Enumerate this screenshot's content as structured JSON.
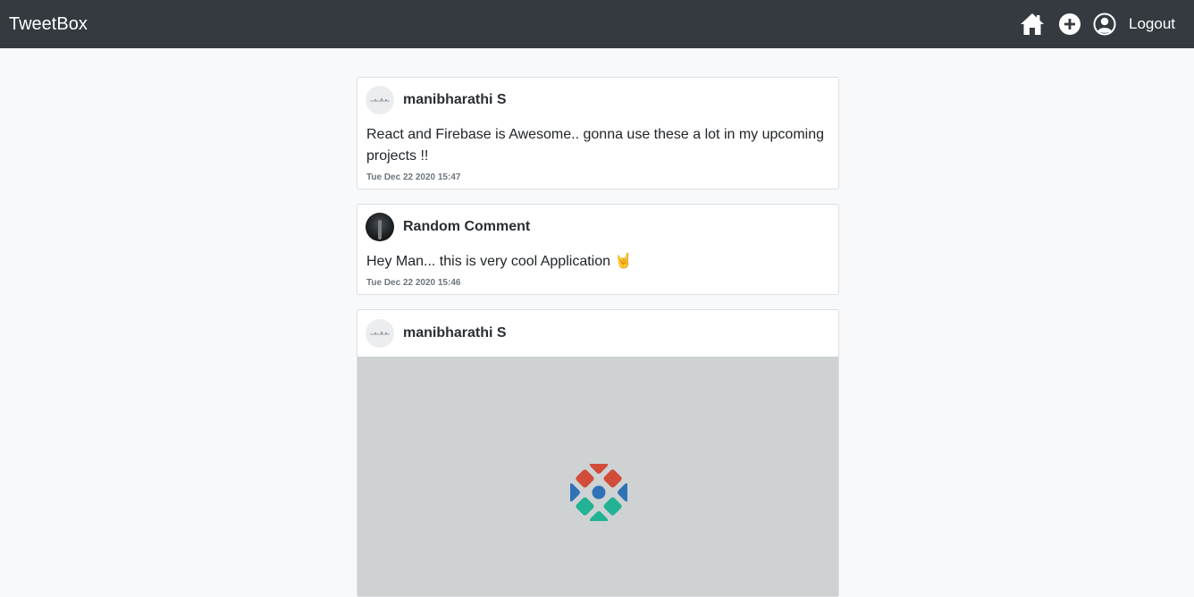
{
  "navbar": {
    "brand": "TweetBox",
    "icons": [
      "home-icon",
      "add-circle-icon",
      "user-circle-icon"
    ],
    "logout_label": "Logout"
  },
  "feed": {
    "posts": [
      {
        "author": "manibharathi S",
        "avatar": "light",
        "text": "React and Firebase is Awesome.. gonna use these a lot in my upcoming projects !!",
        "timestamp": "Tue Dec 22 2020 15:47"
      },
      {
        "author": "Random Comment",
        "avatar": "dark",
        "text": "Hey Man... this is very cool Application 🤘",
        "timestamp": "Tue Dec 22 2020 15:46"
      },
      {
        "author": "manibharathi S",
        "avatar": "light",
        "image": "diamond-logo-image"
      }
    ]
  },
  "colors": {
    "navbar_bg": "#343a40",
    "page_bg": "#f8f9fa",
    "image_bg": "#ced2d3",
    "logo_red": "#d24c3a",
    "logo_blue": "#2f72b6",
    "logo_teal": "#22b394"
  }
}
